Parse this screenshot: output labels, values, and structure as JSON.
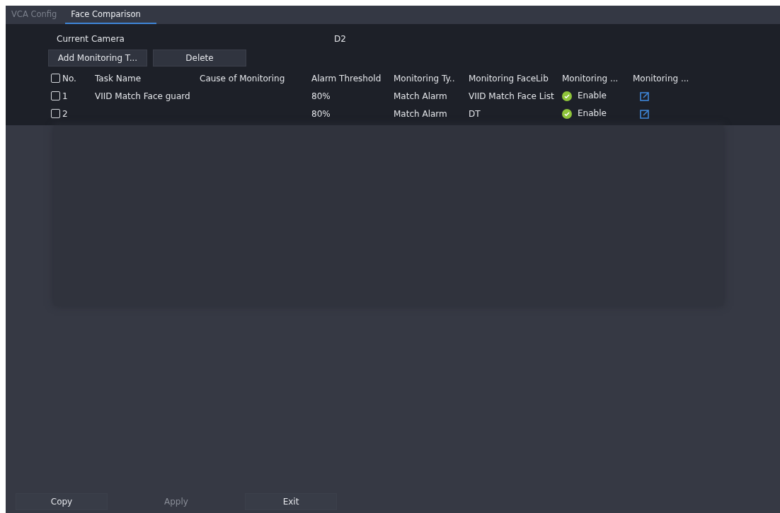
{
  "tabs": [
    {
      "label": "VCA Config",
      "selected": false
    },
    {
      "label": "Face Comparison",
      "selected": true
    }
  ],
  "current_camera": {
    "label": "Current Camera",
    "value": "D2"
  },
  "toolbar": [
    {
      "label": "Add Monitoring T...",
      "disabled": false
    },
    {
      "label": "Delete",
      "disabled": false
    }
  ],
  "table": {
    "select_all_checked": false,
    "columns": [
      "No.",
      "Task Name",
      "Cause of Monitoring",
      "Alarm Threshold",
      "Monitoring Ty..",
      "Monitoring FaceLib",
      "Monitoring ...",
      "Monitoring ..."
    ],
    "rows": [
      {
        "checked": false,
        "no": "1",
        "task_name": "VIID Match Face guard",
        "cause": "",
        "threshold": "80%",
        "type": "Match Alarm",
        "facelib": "VIID Match Face List",
        "status": "Enable",
        "enabled": true
      },
      {
        "checked": false,
        "no": "2",
        "task_name": "",
        "cause": "",
        "threshold": "80%",
        "type": "Match Alarm",
        "facelib": "DT",
        "status": "Enable",
        "enabled": true
      }
    ]
  },
  "buttons": [
    {
      "label": "Copy",
      "disabled": false
    },
    {
      "label": "Apply",
      "disabled": true
    },
    {
      "label": "Exit",
      "disabled": false
    }
  ]
}
